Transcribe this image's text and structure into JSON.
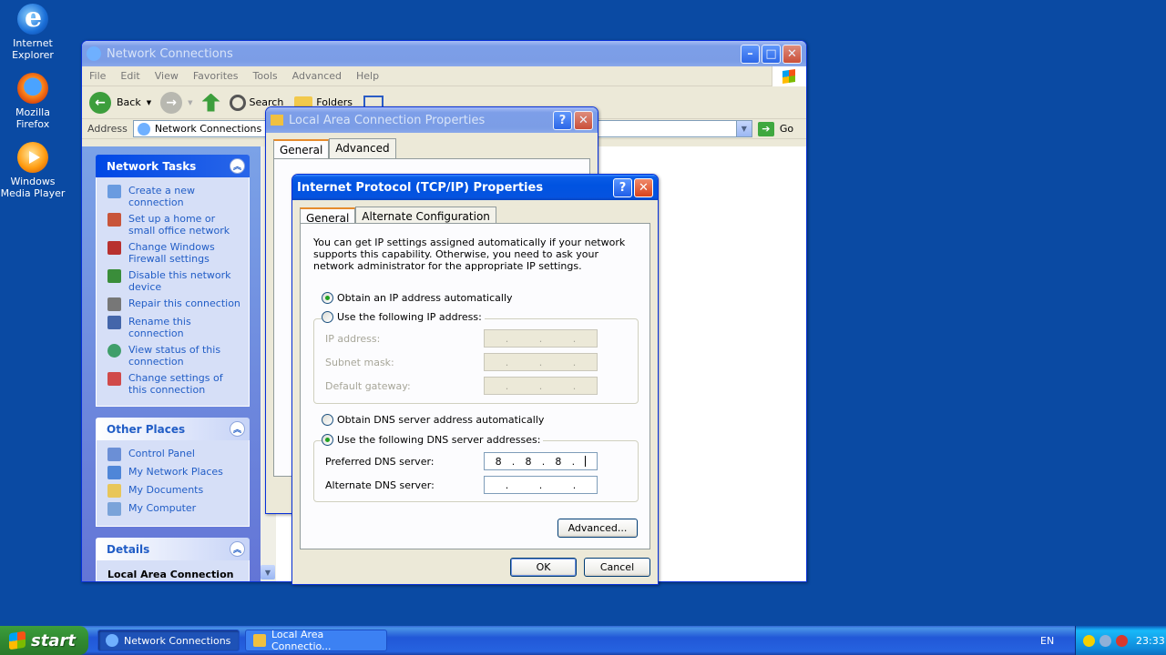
{
  "desktop": {
    "icons": [
      {
        "label1": "Internet",
        "label2": "Explorer"
      },
      {
        "label1": "Mozilla Firefox",
        "label2": ""
      },
      {
        "label1": "Windows",
        "label2": "Media Player"
      }
    ]
  },
  "nc": {
    "title": "Network Connections",
    "menu": [
      "File",
      "Edit",
      "View",
      "Favorites",
      "Tools",
      "Advanced",
      "Help"
    ],
    "toolbar": {
      "back": "Back",
      "search": "Search",
      "folders": "Folders"
    },
    "address": {
      "label": "Address",
      "value": "Network Connections",
      "go": "Go"
    },
    "network_tasks": {
      "title": "Network Tasks",
      "items": [
        "Create a new connection",
        "Set up a home or small office network",
        "Change Windows Firewall settings",
        "Disable this network device",
        "Repair this connection",
        "Rename this connection",
        "View status of this connection",
        "Change settings of this connection"
      ]
    },
    "other_places": {
      "title": "Other Places",
      "items": [
        "Control Panel",
        "My Network Places",
        "My Documents",
        "My Computer"
      ]
    },
    "details": {
      "title": "Details",
      "name": "Local Area Connection"
    }
  },
  "lan": {
    "title": "Local Area Connection Properties",
    "tabs": [
      "General",
      "Advanced"
    ]
  },
  "tcp": {
    "title": "Internet Protocol (TCP/IP) Properties",
    "tabs": [
      "General",
      "Alternate Configuration"
    ],
    "intro": "You can get IP settings assigned automatically if your network supports this capability. Otherwise, you need to ask your network administrator for the appropriate IP settings.",
    "ip_auto": "Obtain an IP address automatically",
    "ip_manual": "Use the following IP address:",
    "ip_address_label": "IP address:",
    "subnet_label": "Subnet mask:",
    "gateway_label": "Default gateway:",
    "dns_auto": "Obtain DNS server address automatically",
    "dns_manual": "Use the following DNS server addresses:",
    "preferred_dns_label": "Preferred DNS server:",
    "preferred_dns": [
      "8",
      "8",
      "8",
      ""
    ],
    "alternate_dns_label": "Alternate DNS server:",
    "advanced": "Advanced...",
    "ok": "OK",
    "cancel": "Cancel"
  },
  "taskbar": {
    "start": "start",
    "tasks": [
      "Network Connections",
      "Local Area Connectio..."
    ],
    "lang": "EN",
    "clock": "23:33"
  }
}
